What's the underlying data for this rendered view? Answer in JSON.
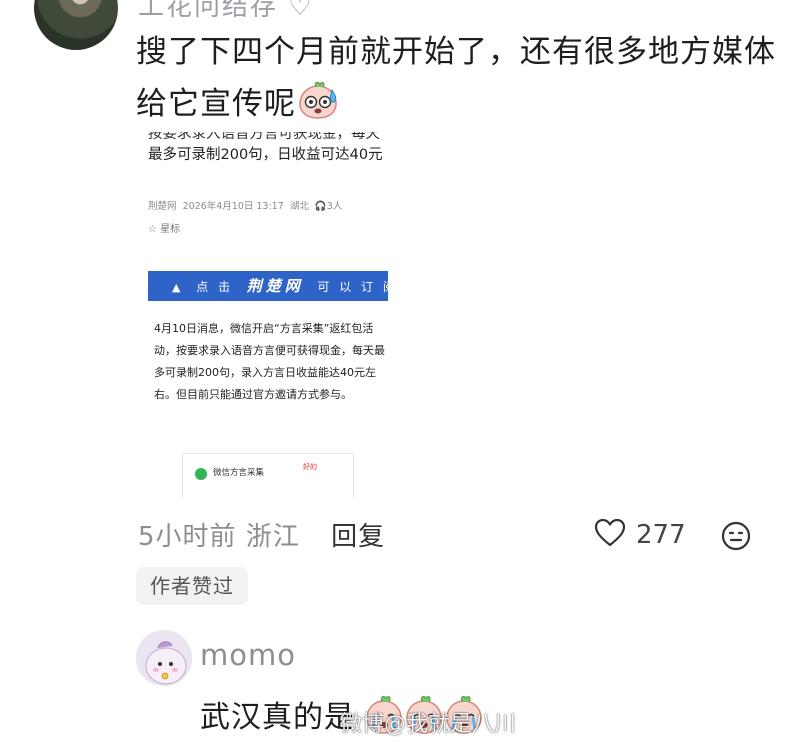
{
  "top_comment": {
    "username_partial": "工花问结存 ♡",
    "text": "搜了下四个月前就开始了，还有很多地方媒体给它宣传呢",
    "emoji": "sweat-peach-emoji",
    "embedded_article": {
      "title_top_cut": "按要求录入语音方言可获现金，每天",
      "title": "最多可录制200句，日收益可达40元",
      "source": "荆楚网",
      "datetime": "2026年4月10日 13:17",
      "region": "湖北",
      "listeners": "3人",
      "star_label": "星标",
      "banner": {
        "prefix": "点 击",
        "logo": "荆楚网",
        "suffix": "可 以 订 阅"
      },
      "body": "4月10日消息，微信开启“方言采集”返红包活动，按要求录入语音方言便可获得现金，每天最多可录制200句，录入方言日收益能达40元左右。但目前只能通过官方邀请方式参与。",
      "mini_card_label": "微信方言采集",
      "mini_card_tag": "好的"
    },
    "time": "5小时前",
    "location": "浙江",
    "reply_label": "回复",
    "like_count": "277",
    "author_liked_badge": "作者赞过"
  },
  "reply_comment": {
    "username": "momo",
    "text": "武汉真的是",
    "emojis": [
      "crying-peach-emoji",
      "crying-peach-emoji",
      "crying-peach-emoji"
    ]
  },
  "watermark": "微博@我就是八川"
}
